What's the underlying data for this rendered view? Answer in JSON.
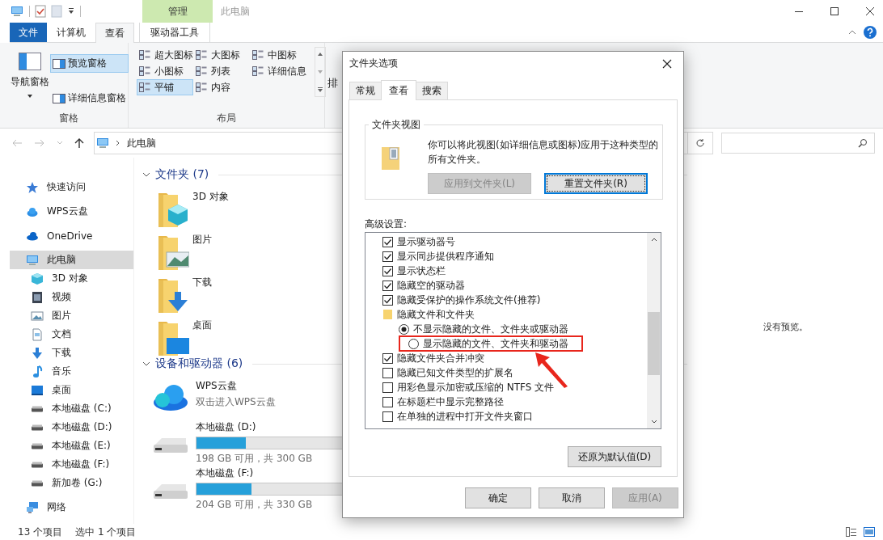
{
  "explorer": {
    "context_tab_group": "管理",
    "title": "此电脑",
    "ribbon_tabs": [
      {
        "label": "文件",
        "kind": "file",
        "selected": false
      },
      {
        "label": "计算机",
        "kind": "normal",
        "selected": false
      },
      {
        "label": "查看",
        "kind": "normal",
        "selected": true
      },
      {
        "label": "驱动器工具",
        "kind": "context",
        "selected": false
      }
    ],
    "panes_group": {
      "label": "窗格",
      "nav_pane": "导航窗格",
      "buttons": [
        {
          "label": "预览窗格",
          "selected": true
        },
        {
          "label": "详细信息窗格",
          "selected": false
        }
      ]
    },
    "layout_group": {
      "label": "布局",
      "options": [
        {
          "label": "超大图标",
          "selected": false
        },
        {
          "label": "大图标",
          "selected": false
        },
        {
          "label": "中图标",
          "selected": false
        },
        {
          "label": "小图标",
          "selected": false
        },
        {
          "label": "列表",
          "selected": false
        },
        {
          "label": "详细信息",
          "selected": false
        },
        {
          "label": "平铺",
          "selected": true
        },
        {
          "label": "内容",
          "selected": false
        }
      ]
    },
    "cut_group_label": "排",
    "address": {
      "path": "此电脑"
    },
    "sidebar": {
      "items": [
        {
          "label": "快速访问",
          "kind": "star",
          "selected": false
        },
        {
          "label": "WPS云盘",
          "kind": "cloud",
          "selected": false
        },
        {
          "label": "OneDrive",
          "kind": "onedrive",
          "selected": false
        },
        {
          "label": "此电脑",
          "kind": "pc",
          "selected": true,
          "children": [
            {
              "label": "3D 对象",
              "kind": "cube",
              "selected": false
            },
            {
              "label": "视频",
              "kind": "video",
              "selected": false
            },
            {
              "label": "图片",
              "kind": "picture",
              "selected": false
            },
            {
              "label": "文档",
              "kind": "document",
              "selected": false
            },
            {
              "label": "下载",
              "kind": "download",
              "selected": false
            },
            {
              "label": "音乐",
              "kind": "music",
              "selected": false
            },
            {
              "label": "桌面",
              "kind": "desktop",
              "selected": false
            },
            {
              "label": "本地磁盘 (C:)",
              "kind": "drive",
              "selected": false
            },
            {
              "label": "本地磁盘 (D:)",
              "kind": "drive",
              "selected": false
            },
            {
              "label": "本地磁盘 (E:)",
              "kind": "drive",
              "selected": false
            },
            {
              "label": "本地磁盘 (F:)",
              "kind": "drive",
              "selected": false
            },
            {
              "label": "新加卷 (G:)",
              "kind": "drive",
              "selected": false
            }
          ]
        },
        {
          "label": "网络",
          "kind": "network",
          "selected": false
        }
      ]
    },
    "folders_section": {
      "title": "文件夹 (7)",
      "items": [
        {
          "name": "3D 对象",
          "kind": "cube"
        },
        {
          "name": "图片",
          "kind": "picture"
        },
        {
          "name": "下载",
          "kind": "download"
        },
        {
          "name": "桌面",
          "kind": "desktop"
        }
      ]
    },
    "devices_section": {
      "title": "设备和驱动器 (6)",
      "items": [
        {
          "kind": "cloud",
          "name": "WPS云盘",
          "subtitle": "双击进入WPS云盘"
        },
        {
          "kind": "drive",
          "name": "本地磁盘 (D:)",
          "level": 0.34,
          "subtitle": "198 GB 可用，共 300 GB"
        },
        {
          "kind": "drive",
          "name": "本地磁盘 (F:)",
          "level": 0.38,
          "subtitle": "204 GB 可用，共 330 GB"
        }
      ]
    },
    "preview": "没有预览。",
    "status_bar": {
      "item_count": "13 个项目",
      "selection": "选中 1 个项目"
    }
  },
  "dialog": {
    "title": "文件夹选项",
    "tabs": [
      {
        "label": "常规",
        "selected": false
      },
      {
        "label": "查看",
        "selected": true
      },
      {
        "label": "搜索",
        "selected": false
      }
    ],
    "folder_views": {
      "title": "文件夹视图",
      "description": "你可以将此视图(如详细信息或图标)应用于这种类型的所有文件夹。",
      "buttons": [
        {
          "label": "应用到文件夹(L)",
          "disabled": true
        },
        {
          "label": "重置文件夹(R)",
          "disabled": false
        }
      ]
    },
    "advanced": {
      "label": "高级设置:",
      "items": [
        {
          "kind": "checkbox",
          "label": "显示驱动器号",
          "checked": true
        },
        {
          "kind": "checkbox",
          "label": "显示同步提供程序通知",
          "checked": true
        },
        {
          "kind": "checkbox",
          "label": "显示状态栏",
          "checked": true
        },
        {
          "kind": "checkbox",
          "label": "隐藏空的驱动器",
          "checked": true
        },
        {
          "kind": "checkbox",
          "label": "隐藏受保护的操作系统文件(推荐)",
          "checked": true
        },
        {
          "kind": "folder",
          "label": "隐藏文件和文件夹",
          "children": [
            {
              "kind": "radio",
              "label": "不显示隐藏的文件、文件夹或驱动器",
              "selected": true,
              "highlighted": false
            },
            {
              "kind": "radio",
              "label": "显示隐藏的文件、文件夹和驱动器",
              "selected": false,
              "highlighted": true
            }
          ]
        },
        {
          "kind": "checkbox",
          "label": "隐藏文件夹合并冲突",
          "checked": true
        },
        {
          "kind": "checkbox",
          "label": "隐藏已知文件类型的扩展名",
          "checked": false
        },
        {
          "kind": "checkbox",
          "label": "用彩色显示加密或压缩的 NTFS 文件",
          "checked": false
        },
        {
          "kind": "checkbox",
          "label": "在标题栏中显示完整路径",
          "checked": false
        },
        {
          "kind": "checkbox",
          "label": "在单独的进程中打开文件夹窗口",
          "checked": false
        }
      ]
    },
    "restore_button": "还原为默认值(D)",
    "footer_buttons": [
      {
        "label": "确定",
        "disabled": false
      },
      {
        "label": "取消",
        "disabled": false
      },
      {
        "label": "应用(A)",
        "disabled": true
      }
    ]
  }
}
